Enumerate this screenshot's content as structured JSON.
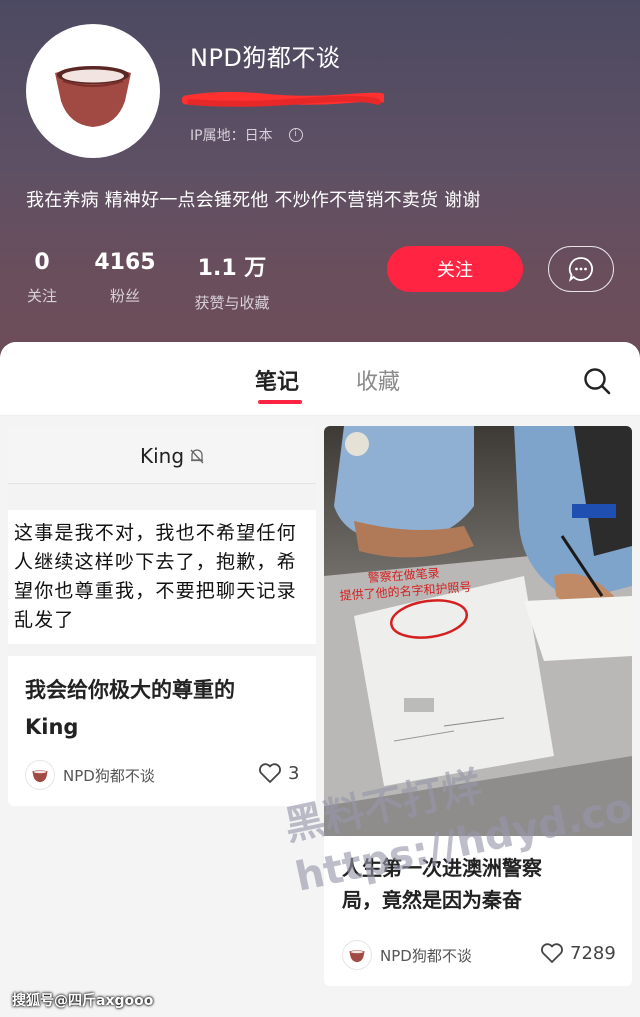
{
  "profile": {
    "name": "NPD狗都不谈",
    "ip_location": "IP属地：日本",
    "bio": "我在养病 精神好一点会锤死他 不炒作不营销不卖货 谢谢",
    "stats": [
      {
        "value": "0",
        "label": "关注"
      },
      {
        "value": "4165",
        "label": "粉丝"
      },
      {
        "value": "1.1 万",
        "label": "获赞与收藏"
      }
    ],
    "follow_label": "关注",
    "accent_color": "#ff2442"
  },
  "tabs": [
    {
      "label": "笔记",
      "active": true
    },
    {
      "label": "收藏",
      "active": false
    }
  ],
  "notes": [
    {
      "cover_chat_name": "King",
      "cover_text_lines": [
        "这事是我不对，我也不希望任何",
        "人继续这样吵下去了，抱歉，希",
        "望你也尊重我，不要把聊天记录",
        "乱发了"
      ],
      "title_line1": "我会给你极大的尊重的",
      "title_line2": "King",
      "author": "NPD狗都不谈",
      "likes": "3"
    },
    {
      "photo_annotation_line1": "警察在做笔录",
      "photo_annotation_line2": "提供了他的名字和护照号",
      "title_line1": "人生第一次进澳洲警察",
      "title_line2": "局，竟然是因为秦奋",
      "author": "NPD狗都不谈",
      "likes": "7289"
    }
  ],
  "watermark": {
    "line1": "黑料不打烊",
    "line2": "https://hdyd.co"
  },
  "footer_credit": "搜狐号@四斤axgooo"
}
